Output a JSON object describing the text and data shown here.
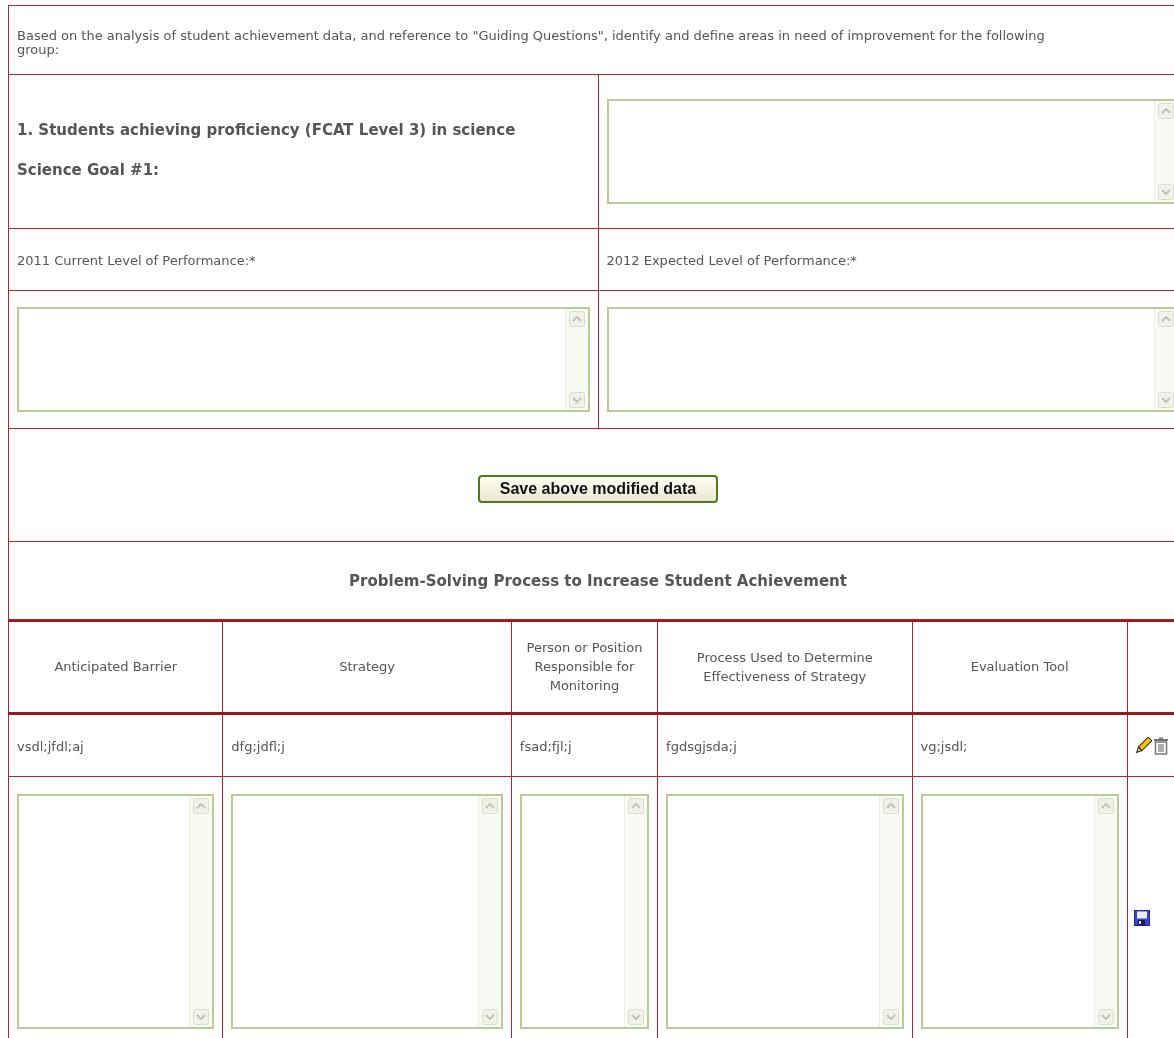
{
  "intro": "Based on the analysis of student achievement data, and reference to \"Guiding Questions\", identify and define areas in need of improvement for the following group:",
  "goal": {
    "heading": "1. Students achieving proficiency (FCAT Level 3) in science",
    "label": "Science Goal #1:"
  },
  "performance": [
    {
      "label": "2011 Current Level of Performance:*"
    },
    {
      "label": "2012 Expected Level of Performance:*"
    }
  ],
  "save_button": "Save above modified data",
  "section_title": "Problem-Solving Process to Increase Student Achievement",
  "table": {
    "columns": [
      "Anticipated Barrier",
      "Strategy",
      "Person or Position Responsible for Monitoring",
      "Process Used to Determine Effectiveness of Strategy",
      "Evaluation Tool"
    ],
    "rows": [
      {
        "cells": [
          "vsdl;jfdl;aj",
          "dfg;jdfl;j",
          "fsad;fjl;j",
          "fgdsgjsda;j",
          "vg;jsdl;"
        ]
      }
    ]
  }
}
